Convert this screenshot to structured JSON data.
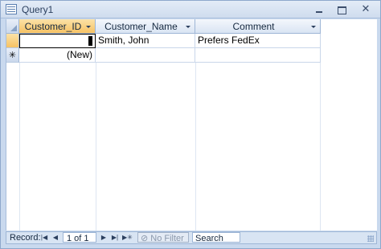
{
  "window": {
    "title": "Query1",
    "icon": "query-icon"
  },
  "datasheet": {
    "columns": [
      {
        "label": "Customer_ID"
      },
      {
        "label": "Customer_Name"
      },
      {
        "label": "Comment"
      }
    ],
    "rows": [
      {
        "customer_id": "",
        "customer_name": "Smith, John",
        "comment": "Prefers FedEx"
      }
    ],
    "new_row": {
      "marker": "✳",
      "customer_id": "(New)"
    }
  },
  "statusbar": {
    "record_label": "Record:",
    "record_position": "1 of 1",
    "filter_label": "No Filter",
    "search_placeholder": "Search"
  },
  "colors": {
    "active_header": "#f6c264",
    "header": "#d9e4f3",
    "frame": "#c9d9ee"
  }
}
